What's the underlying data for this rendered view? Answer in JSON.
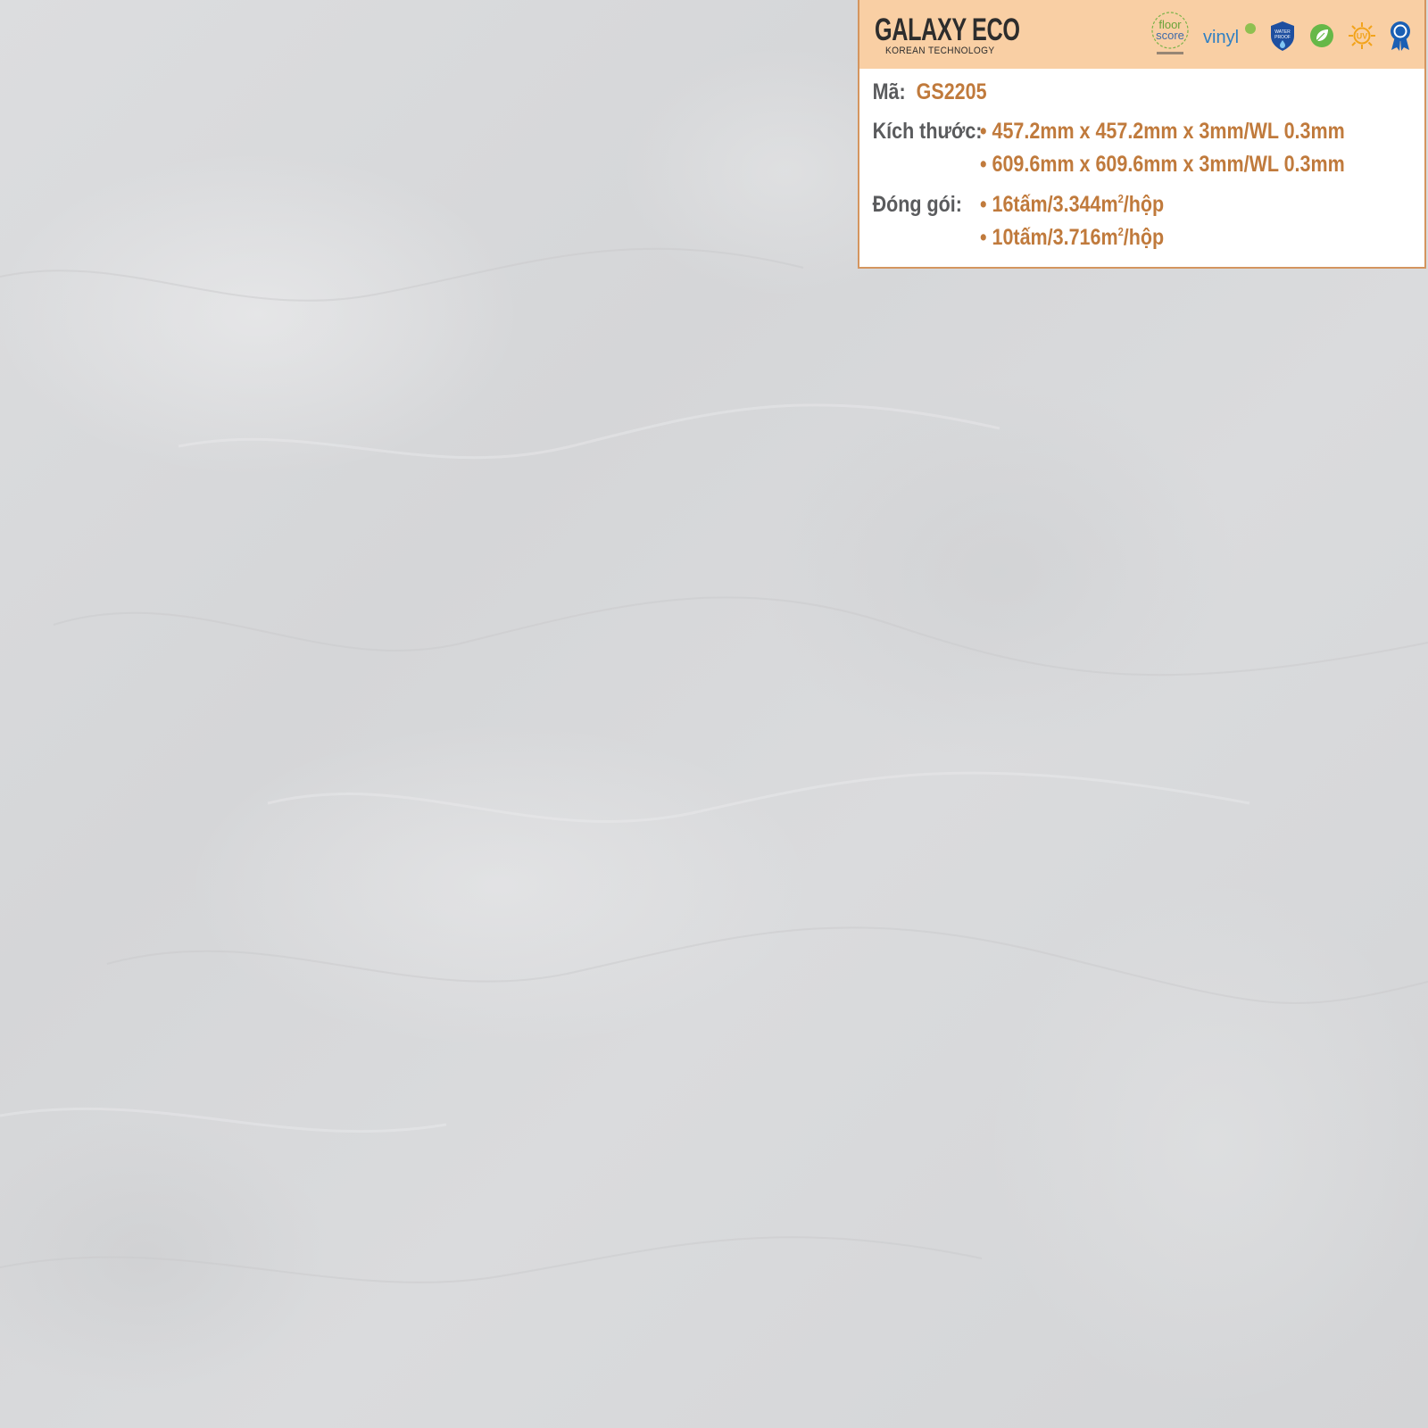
{
  "brand": {
    "name": "GALAXY ECO",
    "tagline": "KOREAN TECHNOLOGY"
  },
  "badges": {
    "floorscore_line1": "floor",
    "floorscore_line2": "score",
    "vinyl": "vinyl",
    "waterproof": "WATER PROOF",
    "uv": "UV"
  },
  "product": {
    "code_label": "Mã:",
    "code": "GS2205",
    "size_label": "Kích thước:",
    "sizes": [
      "• 457.2mm x 457.2mm x 3mm/WL 0.3mm",
      "• 609.6mm x 609.6mm x 3mm/WL 0.3mm"
    ],
    "packing_label": "Đóng gói:",
    "packing": [
      {
        "prefix": "• 16tấm/3.344m",
        "sup": "2",
        "suffix": "/hộp"
      },
      {
        "prefix": "• 10tấm/3.716m",
        "sup": "2",
        "suffix": "/hộp"
      }
    ]
  },
  "colors": {
    "header_bg": "#f9cfa4",
    "value_text": "#c07a3c",
    "label_text": "#5a5b5d",
    "border": "#d4955f",
    "stone": "#d8d9db"
  }
}
